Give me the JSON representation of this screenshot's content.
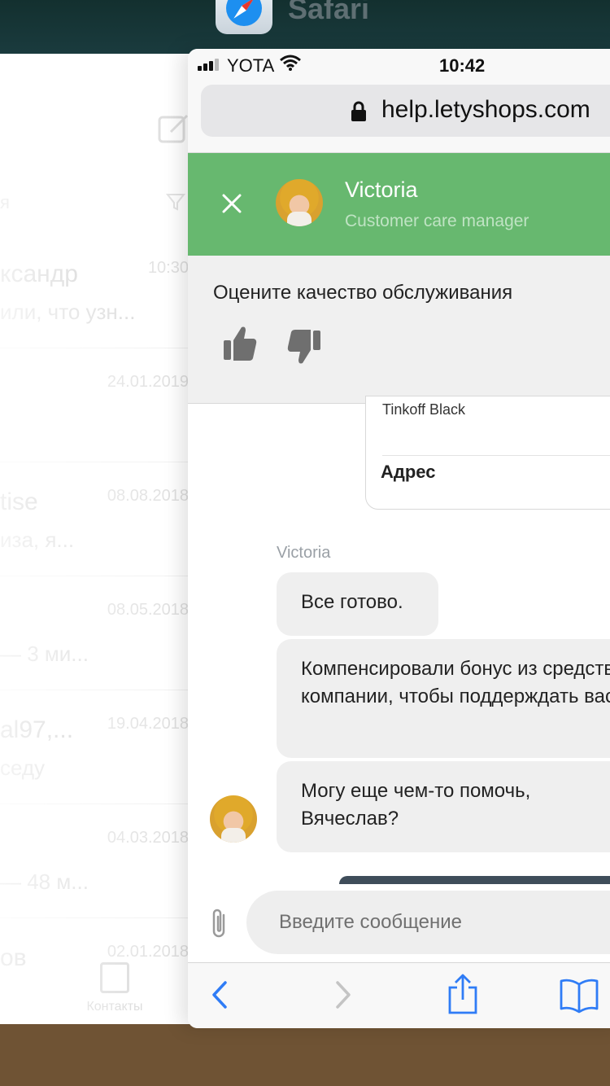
{
  "app_switcher": {
    "app_label": "Safari",
    "app_icon": "safari-compass-icon"
  },
  "background_app": {
    "rows": [
      {
        "name": "ксандр",
        "date": "10:30",
        "preview": "или, что узн..."
      },
      {
        "name": "",
        "date": "24.01.2019",
        "preview": ""
      },
      {
        "name": "tise",
        "date": "08.08.2018",
        "preview": "иза, я..."
      },
      {
        "name": "",
        "date": "08.05.2018",
        "preview": "— 3 ми..."
      },
      {
        "name": "al97,...",
        "date": "19.04.2018",
        "preview": "седу"
      },
      {
        "name": "",
        "date": "04.03.2018",
        "preview": "— 48 м..."
      },
      {
        "name": "ов",
        "date": "02.01.2018",
        "preview": ""
      }
    ],
    "tab_label": "Контакты",
    "search_placeholder": "я"
  },
  "status_bar": {
    "carrier": "YOTA",
    "time": "10:42"
  },
  "address_bar": {
    "url": "help.letyshops.com",
    "secure_icon": "lock-icon"
  },
  "chat_header": {
    "agent_name": "Victoria",
    "agent_role": "Customer care manager",
    "close_icon": "close-icon"
  },
  "rating": {
    "title": "Оцените качество обслуживания",
    "up_icon": "thumbs-up-icon",
    "down_icon": "thumbs-down-icon"
  },
  "chat": {
    "card": {
      "bank_text": "Tinkoff Black",
      "address_label": "Адрес"
    },
    "sender": "Victoria",
    "messages": [
      "Все готово.",
      "Компенсировали бонус из средств компании, чтобы поддерждать вас.",
      "Могу еще чем-то помочь, Вячеслав?"
    ]
  },
  "composer": {
    "placeholder": "Введите сообщение",
    "attach_icon": "paperclip-icon"
  },
  "toolbar": {
    "back_icon": "chevron-left-icon",
    "forward_icon": "chevron-right-icon",
    "share_icon": "share-icon",
    "bookmarks_icon": "book-icon"
  },
  "colors": {
    "header_green": "#67b86f",
    "ios_blue": "#2f7cf6",
    "bubble_gray": "#efefef",
    "role_text": "#bfe3c3"
  }
}
